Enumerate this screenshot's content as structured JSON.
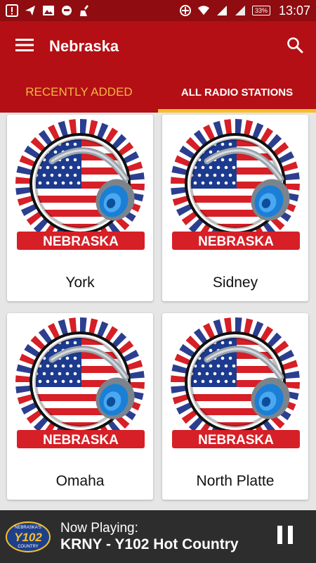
{
  "status_bar": {
    "time": "13:07",
    "battery": "33%",
    "icons": [
      "notification-icon",
      "send-icon",
      "image-icon",
      "robot-icon",
      "cleaner-icon",
      "sync-icon",
      "wifi-icon",
      "signal-icon",
      "signal-2-icon",
      "battery-icon"
    ]
  },
  "appbar": {
    "title": "Nebraska",
    "menu_icon": "menu-icon",
    "search_icon": "search-icon"
  },
  "tabs": [
    {
      "label": "RECENTLY ADDED"
    },
    {
      "label": "ALL RADIO STATIONS"
    }
  ],
  "logo_text": "NEBRASKA",
  "cards": [
    {
      "name": "York"
    },
    {
      "name": "Sidney"
    },
    {
      "name": "Omaha"
    },
    {
      "name": "North Platte"
    }
  ],
  "player": {
    "label": "Now Playing:",
    "station": "KRNY - Y102 Hot Country",
    "logo_text": "Y102",
    "logo_top": "NEBRASKA'S",
    "logo_sub": "COUNTRY",
    "pause_icon": "pause-icon"
  },
  "colors": {
    "primary": "#b30f15",
    "status": "#8f0c10",
    "accent": "#f6c02b",
    "tab_inactive": "#f5b642",
    "player_bg": "#2d2d2d"
  }
}
